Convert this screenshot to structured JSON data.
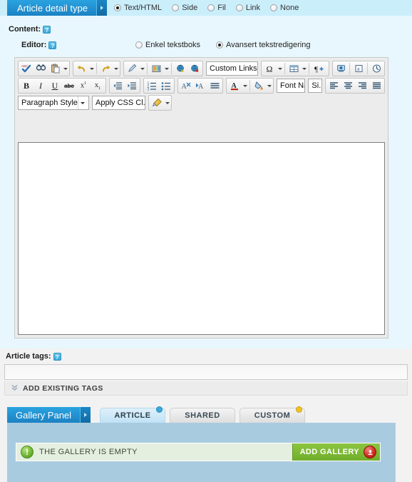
{
  "section": {
    "tab_label": "Article detail type",
    "detail_types": [
      {
        "label": "Text/HTML",
        "selected": true
      },
      {
        "label": "Side",
        "selected": false
      },
      {
        "label": "Fil",
        "selected": false
      },
      {
        "label": "Link",
        "selected": false
      },
      {
        "label": "None",
        "selected": false
      }
    ]
  },
  "content": {
    "label": "Content:",
    "help_glyph": "?",
    "editor_label": "Editor:",
    "editor_modes": [
      {
        "label": "Enkel tekstboks",
        "selected": false
      },
      {
        "label": "Avansert tekstredigering",
        "selected": true
      }
    ]
  },
  "editor": {
    "toolbar_row1": [
      {
        "name": "spellcheck-button",
        "icon": "spellcheck-icon",
        "caret": false
      },
      {
        "name": "find-replace-button",
        "icon": "binoculars-icon",
        "caret": false
      },
      {
        "name": "paste-button",
        "icon": "clipboard-icon",
        "caret": true
      },
      {
        "name": "undo-button",
        "icon": "undo-arrow-icon",
        "caret": true
      },
      {
        "name": "redo-button",
        "icon": "redo-arrow-icon",
        "caret": true
      },
      {
        "name": "format-eraser-button",
        "icon": "pencil-icon",
        "caret": true
      },
      {
        "name": "insert-image-button",
        "icon": "image-icon",
        "caret": true
      },
      {
        "name": "insert-link-button",
        "icon": "globe-link-icon",
        "caret": false
      },
      {
        "name": "remove-link-button",
        "icon": "globe-unlink-icon",
        "caret": false
      }
    ],
    "custom_links_select": "Custom Links",
    "toolbar_row1b": [
      {
        "name": "special-character-button",
        "icon": "omega-icon",
        "caret": true
      },
      {
        "name": "insert-table-button",
        "icon": "table-icon",
        "caret": true
      },
      {
        "name": "paragraph-mark-button",
        "icon": "pilcrow-plus-icon",
        "caret": false
      },
      {
        "name": "insert-media-button",
        "icon": "media-icon",
        "caret": false
      },
      {
        "name": "insert-form-button",
        "icon": "form-icon",
        "caret": false
      },
      {
        "name": "insert-date-time-button",
        "icon": "clock-icon",
        "caret": false
      }
    ],
    "toolbar_row2": [
      {
        "name": "bold-button",
        "glyph": "B"
      },
      {
        "name": "italic-button",
        "glyph": "I"
      },
      {
        "name": "underline-button",
        "glyph": "U"
      },
      {
        "name": "strikethrough-button",
        "glyph": "abc"
      },
      {
        "name": "superscript-button",
        "glyph": "x¹"
      },
      {
        "name": "subscript-button",
        "glyph": "x₁"
      }
    ],
    "toolbar_row2b": [
      {
        "name": "decrease-indent-button",
        "icon": "outdent-icon"
      },
      {
        "name": "increase-indent-button",
        "icon": "indent-icon"
      },
      {
        "name": "numbered-list-button",
        "icon": "ordered-list-icon"
      },
      {
        "name": "bulleted-list-button",
        "icon": "bulleted-list-icon"
      },
      {
        "name": "remove-formatting-button",
        "icon": "clear-format-icon"
      },
      {
        "name": "text-direction-button",
        "icon": "text-direction-icon"
      },
      {
        "name": "blockquote-button",
        "icon": "blockquote-icon"
      }
    ],
    "font_color_buttons": [
      {
        "name": "font-color-button",
        "icon": "letter-a-icon"
      },
      {
        "name": "highlight-color-button",
        "icon": "paint-bucket-icon"
      }
    ],
    "font_name_select": "Font Name",
    "font_size_select": "Si...",
    "align_buttons": [
      {
        "name": "align-left-button",
        "icon": "align-left-icon"
      },
      {
        "name": "align-center-button",
        "icon": "align-center-icon"
      },
      {
        "name": "align-right-button",
        "icon": "align-right-icon"
      },
      {
        "name": "align-justify-button",
        "icon": "align-justify-icon"
      }
    ],
    "paragraph_style_select": "Paragraph Style",
    "apply_css_select": "Apply CSS Cl...",
    "format_painter": {
      "name": "format-painter-button",
      "icon": "format-painter-icon"
    },
    "content_value": ""
  },
  "tags": {
    "label": "Article tags:",
    "help_glyph": "?",
    "input_value": "",
    "input_placeholder": "",
    "add_existing_label": "ADD EXISTING TAGS"
  },
  "gallery": {
    "panel_tab_label": "Gallery Panel",
    "tabs": [
      {
        "label": "ARTICLE",
        "active": true,
        "badge": "#38a9dd"
      },
      {
        "label": "SHARED",
        "active": false,
        "badge": null
      },
      {
        "label": "CUSTOM",
        "active": false,
        "badge": "#f2c423"
      }
    ],
    "empty_message": "THE GALLERY IS EMPTY",
    "add_button_label": "ADD GALLERY"
  },
  "colors": {
    "brand_blue": "#1b82c4",
    "panel_light_blue": "#e8f7fd",
    "gallery_blue": "#a9cbe0",
    "green_button": "#8cc63f",
    "red_icon": "#d42b20"
  }
}
